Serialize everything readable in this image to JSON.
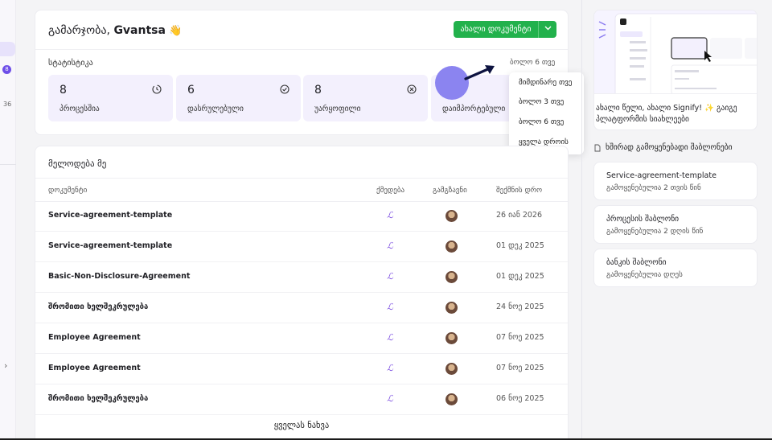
{
  "sidebar": {
    "badge": "8",
    "count": "36",
    "expand_icon": "chevron-right-icon"
  },
  "header": {
    "greeting_prefix": "გამარჯობა, ",
    "user_name": "Gvantsa",
    "wave_emoji": "👋",
    "new_document_label": "ახალი დოკუმენტი"
  },
  "stats": {
    "label": "სტატისტიკა",
    "period": "ბოლო 6 თვე",
    "items": [
      {
        "value": "8",
        "label": "პროცესშია",
        "icon": "clock-progress-icon"
      },
      {
        "value": "6",
        "label": "დასრულებული",
        "icon": "check-circle-icon"
      },
      {
        "value": "8",
        "label": "უარყოფილი",
        "icon": "x-circle-icon"
      },
      {
        "value": "",
        "label": "დაიმპორტებული",
        "icon": "import-icon"
      }
    ]
  },
  "period_dropdown": {
    "options": [
      "მიმდინარე თვე",
      "ბოლო 3 თვე",
      "ბოლო 6 თვე",
      "ყველა დროის"
    ]
  },
  "waiting": {
    "title": "მელოდება მე",
    "columns": [
      "დოკუმენტი",
      "ქმედება",
      "გამგზავნი",
      "შექმნის დრო"
    ],
    "rows": [
      {
        "document": "Service-agreement-template",
        "date": "26 იან 2026"
      },
      {
        "document": "Service-agreement-template",
        "date": "01 დეკ 2025"
      },
      {
        "document": "Basic-Non-Disclosure-Agreement",
        "date": "01 დეკ 2025"
      },
      {
        "document": "შრომითი ხელშეკრულება",
        "date": "24 ნოე 2025"
      },
      {
        "document": "Employee Agreement",
        "date": "07 ნოე 2025"
      },
      {
        "document": "Employee Agreement",
        "date": "07 ნოე 2025"
      },
      {
        "document": "შრომითი ხელშეკრულება",
        "date": "06 ნოე 2025"
      }
    ],
    "view_all": "ყველას ნახვა"
  },
  "promo": {
    "title": "ახალი წელი, ახალი Signify! ✨ გაიგე პლატფორმის სიახლეები"
  },
  "templates": {
    "header": "ხშირად გამოყენებადი შაბლონები",
    "items": [
      {
        "name": "Service-agreement-template",
        "used": "გამოყენებულია 2 თვის წინ"
      },
      {
        "name": "პროცესის შაბლონი",
        "used": "გამოყენებულია 2 დღის წინ"
      },
      {
        "name": "ბანკის შაბლონი",
        "used": "გამოყენებულია დღეს"
      }
    ]
  },
  "colors": {
    "accent": "#6d4ee8",
    "primary_button": "#22b14c",
    "stat_bg": "#f3f0fd"
  }
}
